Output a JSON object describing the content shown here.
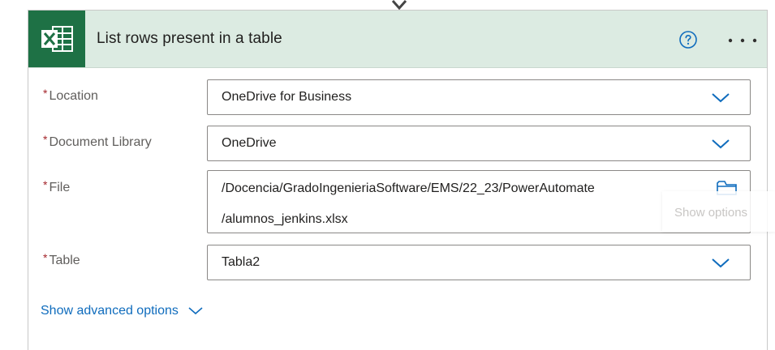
{
  "card": {
    "title": "List rows present in a table",
    "app_icon": "excel-icon",
    "help_icon": "help-circle-icon",
    "more_icon": "more-dots-icon",
    "header_color": "#dcebe2",
    "brand_color": "#1e7145"
  },
  "fields": {
    "required_mark": "*",
    "location": {
      "label": "Location",
      "value": "OneDrive for Business"
    },
    "document_library": {
      "label": "Document Library",
      "value": "OneDrive"
    },
    "file": {
      "label": "File",
      "value_line1": "/Docencia/GradoIngenieriaSoftware/EMS/22_23/PowerAutomate",
      "value_line2": "/alumnos_jenkins.xlsx"
    },
    "table": {
      "label": "Table",
      "value": "Tabla2"
    }
  },
  "advanced": {
    "label": "Show advanced options"
  },
  "tooltip": {
    "text": "Show options"
  }
}
